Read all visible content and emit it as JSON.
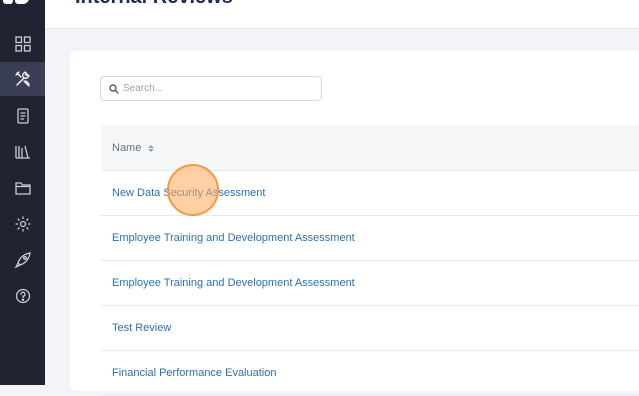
{
  "page": {
    "title": "Internal Reviews"
  },
  "sidebar": {
    "items": [
      {
        "icon": "grid-icon",
        "active": false
      },
      {
        "icon": "tools-icon",
        "active": true
      },
      {
        "icon": "document-icon",
        "active": false
      },
      {
        "icon": "library-icon",
        "active": false
      },
      {
        "icon": "folder-icon",
        "active": false
      },
      {
        "icon": "gear-icon",
        "active": false
      },
      {
        "icon": "rocket-icon",
        "active": false
      },
      {
        "icon": "help-icon",
        "active": false
      }
    ]
  },
  "search": {
    "placeholder": "Search...",
    "value": ""
  },
  "table": {
    "columns": [
      "Name"
    ],
    "rows": [
      {
        "name": "New Data Security Assessment"
      },
      {
        "name": "Employee Training and Development Assessment"
      },
      {
        "name": "Employee Training and Development Assessment"
      },
      {
        "name": "Test Review"
      },
      {
        "name": "Financial Performance Evaluation"
      }
    ]
  },
  "colors": {
    "sidebar_bg": "#1f2332",
    "link": "#2f6fb3",
    "cursor_highlight": "#f2994a"
  }
}
